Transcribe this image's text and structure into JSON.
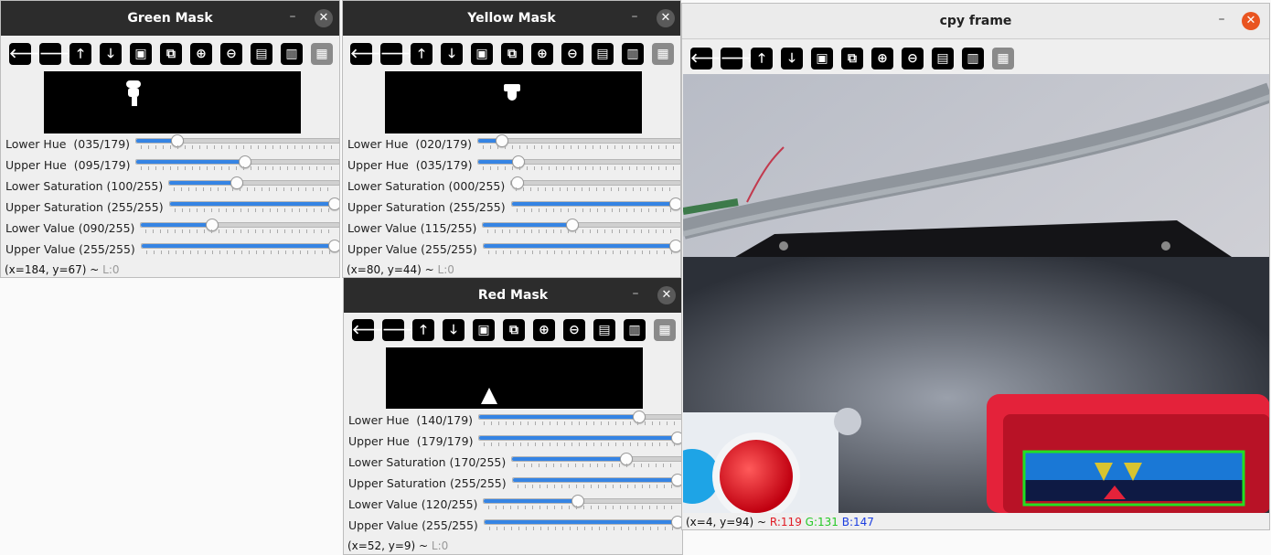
{
  "windows": {
    "green": {
      "title": "Green Mask",
      "min": "–",
      "close": "✕",
      "sliders": [
        {
          "label": "Lower Hue  (035/179)",
          "frac": 0.196
        },
        {
          "label": "Upper Hue  (095/179)",
          "frac": 0.531
        },
        {
          "label": "Lower Saturation (100/255)",
          "frac": 0.392
        },
        {
          "label": "Upper Saturation (255/255)",
          "frac": 1.0
        },
        {
          "label": "Lower Value (090/255)",
          "frac": 0.353
        },
        {
          "label": "Upper Value (255/255)",
          "frac": 1.0
        }
      ],
      "status_coords": "(x=184, y=67) ~ ",
      "status_level": "L:0"
    },
    "yellow": {
      "title": "Yellow Mask",
      "min": "–",
      "close": "✕",
      "sliders": [
        {
          "label": "Lower Hue  (020/179)",
          "frac": 0.112
        },
        {
          "label": "Upper Hue  (035/179)",
          "frac": 0.196
        },
        {
          "label": "Lower Saturation (000/255)",
          "frac": 0.0
        },
        {
          "label": "Upper Saturation (255/255)",
          "frac": 1.0
        },
        {
          "label": "Lower Value (115/255)",
          "frac": 0.451
        },
        {
          "label": "Upper Value (255/255)",
          "frac": 1.0
        }
      ],
      "status_coords": "(x=80, y=44) ~ ",
      "status_level": "L:0"
    },
    "red": {
      "title": "Red Mask",
      "min": "–",
      "close": "✕",
      "sliders": [
        {
          "label": "Lower Hue  (140/179)",
          "frac": 0.782
        },
        {
          "label": "Upper Hue  (179/179)",
          "frac": 1.0
        },
        {
          "label": "Lower Saturation (170/255)",
          "frac": 0.667
        },
        {
          "label": "Upper Saturation (255/255)",
          "frac": 1.0
        },
        {
          "label": "Lower Value (120/255)",
          "frac": 0.471
        },
        {
          "label": "Upper Value (255/255)",
          "frac": 1.0
        }
      ],
      "status_coords": "(x=52, y=9) ~ ",
      "status_level": "L:0"
    },
    "frame": {
      "title": "cpy frame",
      "min": "–",
      "close": "✕",
      "status_coords": "(x=4, y=94) ~ ",
      "status_r": "R:119",
      "status_g": "G:131",
      "status_b": "B:147"
    }
  },
  "toolbar_icons": [
    {
      "name": "pan-left-icon",
      "glyph": "🡐"
    },
    {
      "name": "pan-right-icon",
      "glyph": "🡒"
    },
    {
      "name": "pan-up-icon",
      "glyph": "🡑"
    },
    {
      "name": "pan-down-icon",
      "glyph": "🡓"
    },
    {
      "name": "zoom-original-icon",
      "glyph": "▣"
    },
    {
      "name": "zoom-fit-icon",
      "glyph": "⧉"
    },
    {
      "name": "zoom-in-icon",
      "glyph": "⊕"
    },
    {
      "name": "zoom-out-icon",
      "glyph": "⊖"
    },
    {
      "name": "save-icon",
      "glyph": "▤"
    },
    {
      "name": "properties-icon",
      "glyph": "▥"
    },
    {
      "name": "paint-icon",
      "glyph": "▦"
    }
  ],
  "colors": {
    "slider_fill": "#3584e4",
    "detection_box": "#22e022",
    "close_active": "#e95420"
  }
}
